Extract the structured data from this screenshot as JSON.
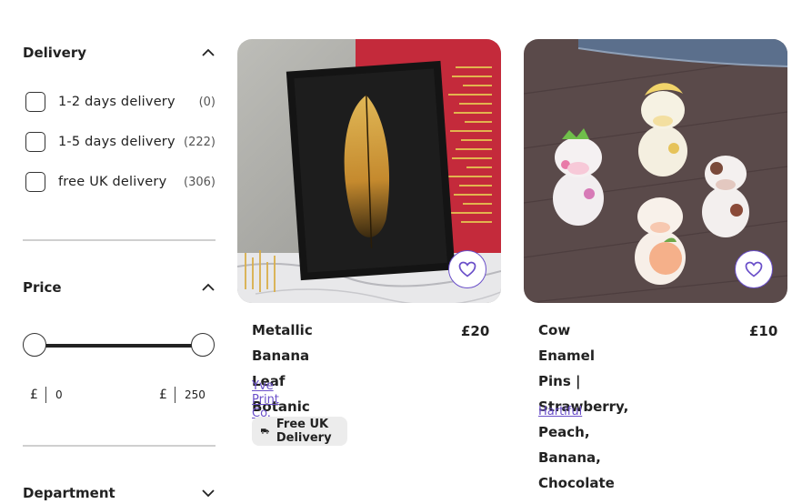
{
  "filters": {
    "delivery": {
      "heading": "Delivery",
      "options": [
        {
          "label": "1-2 days delivery",
          "count": "(0)"
        },
        {
          "label": "1-5 days delivery",
          "count": "(222)"
        },
        {
          "label": "free UK delivery",
          "count": "(306)"
        }
      ]
    },
    "price": {
      "heading": "Price",
      "currency": "£",
      "min_value": "0",
      "max_value": "250"
    },
    "department": {
      "heading": "Department"
    }
  },
  "products": [
    {
      "title_line1": "Metallic Banana Leaf",
      "title_line2": "Botanic Print",
      "price": "£20",
      "shop": "Yve Print Co.",
      "badge": "Free UK Delivery"
    },
    {
      "title_line1": "Cow Enamel Pins |",
      "title_line2": "Strawberry, Peach,",
      "title_line3": "Banana, Chocolate",
      "price": "£10",
      "shop": "Hartiful"
    }
  ],
  "colors": {
    "accent": "#6a4fc9",
    "text": "#222222",
    "divider": "#cfcfcf",
    "badge_bg": "#ececec"
  }
}
